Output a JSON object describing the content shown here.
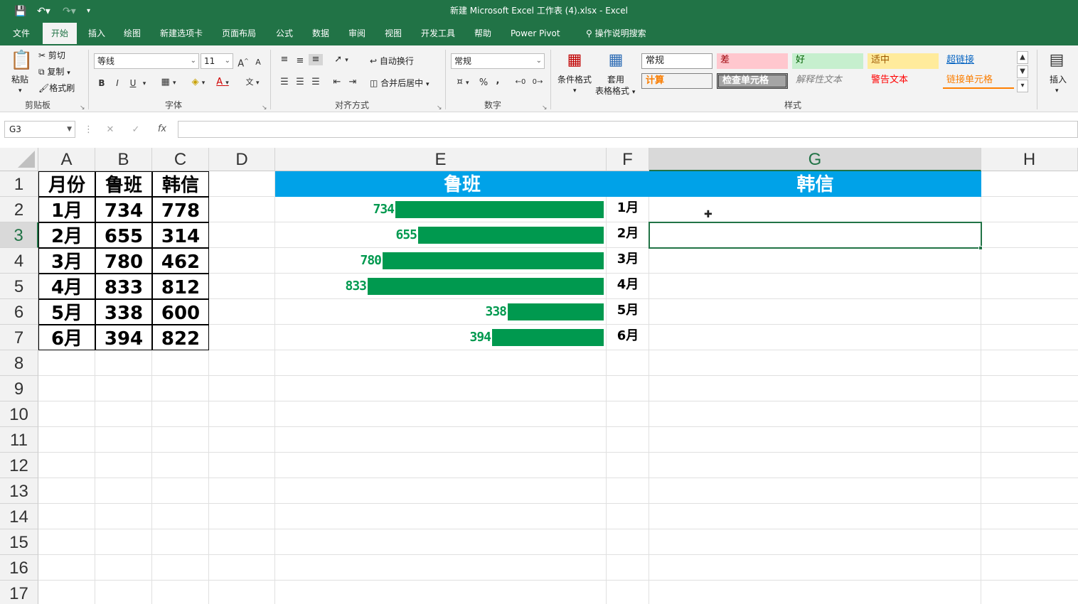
{
  "title": "新建 Microsoft Excel 工作表 (4).xlsx  -  Excel",
  "tabs": [
    "文件",
    "开始",
    "插入",
    "绘图",
    "新建选项卡",
    "页面布局",
    "公式",
    "数据",
    "审阅",
    "视图",
    "开发工具",
    "帮助",
    "Power Pivot",
    "操作说明搜索"
  ],
  "ribbon": {
    "clipboard": {
      "paste": "粘贴",
      "cut": "剪切",
      "copy": "复制",
      "format_painter": "格式刷",
      "label": "剪贴板"
    },
    "font": {
      "name": "等线",
      "size": "11",
      "grow": "A",
      "shrink": "A",
      "bold": "B",
      "italic": "I",
      "underline": "U",
      "label": "字体"
    },
    "alignment": {
      "wrap": "自动换行",
      "merge": "合并后居中",
      "label": "对齐方式"
    },
    "number": {
      "format": "常规",
      "percent": "%",
      "comma": ",",
      "label": "数字"
    },
    "styles": {
      "conditional": "条件格式",
      "table_format_1": "套用",
      "table_format_2": "表格格式",
      "normal": "常规",
      "bad": "差",
      "good": "好",
      "neutral": "适中",
      "hyperlink": "超链接",
      "calc": "计算",
      "check": "检查单元格",
      "explain": "解释性文本",
      "warning": "警告文本",
      "linked": "链接单元格",
      "label": "样式"
    },
    "cells": {
      "insert": "插入"
    }
  },
  "namebox": "G3",
  "columns": [
    "A",
    "B",
    "C",
    "D",
    "E",
    "F",
    "G",
    "H"
  ],
  "rows": [
    "1",
    "2",
    "3",
    "4",
    "5",
    "6",
    "7",
    "8",
    "9",
    "10",
    "11",
    "12",
    "13",
    "14",
    "15",
    "16",
    "17"
  ],
  "table": {
    "headers": [
      "月份",
      "鲁班",
      "韩信"
    ],
    "rows": [
      [
        "1月",
        "734",
        "778"
      ],
      [
        "2月",
        "655",
        "314"
      ],
      [
        "3月",
        "780",
        "462"
      ],
      [
        "4月",
        "833",
        "812"
      ],
      [
        "5月",
        "338",
        "600"
      ],
      [
        "6月",
        "394",
        "822"
      ]
    ]
  },
  "chart_data": {
    "type": "bar",
    "title": "",
    "left_header": "鲁班",
    "right_header": "韩信",
    "categories": [
      "1月",
      "2月",
      "3月",
      "4月",
      "5月",
      "6月"
    ],
    "series": [
      {
        "name": "鲁班",
        "values": [
          734,
          655,
          780,
          833,
          338,
          394
        ]
      }
    ],
    "value_labels": [
      "734",
      "655",
      "780",
      "833",
      "338",
      "394"
    ],
    "bar_color": "#00994f",
    "header_color": "#00a2e8"
  }
}
